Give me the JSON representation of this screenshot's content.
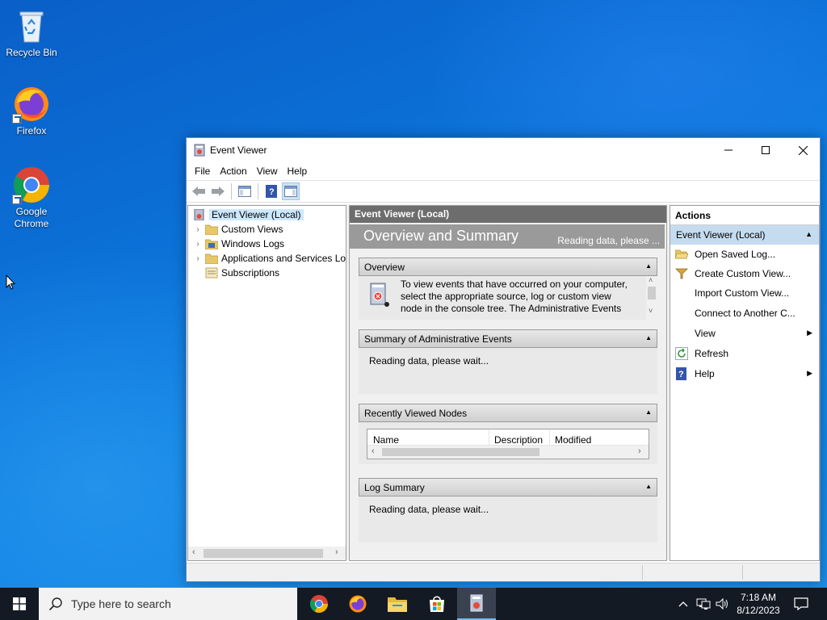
{
  "desktop": {
    "icons": [
      {
        "label": "Recycle Bin"
      },
      {
        "label": "Firefox"
      },
      {
        "label": "Google Chrome"
      }
    ]
  },
  "window": {
    "title": "Event Viewer",
    "menu": [
      "File",
      "Action",
      "View",
      "Help"
    ],
    "tree": [
      {
        "label": "Event Viewer (Local)"
      },
      {
        "label": "Custom Views"
      },
      {
        "label": "Windows Logs"
      },
      {
        "label": "Applications and Services Lo"
      },
      {
        "label": "Subscriptions"
      }
    ],
    "center": {
      "header": "Event Viewer (Local)",
      "banner_title": "Overview and Summary",
      "banner_status": "Reading data, please ...",
      "overview": {
        "title": "Overview",
        "text": [
          "To view events that have occurred on your computer,",
          "select the appropriate source, log or custom view",
          "node in the console tree. The Administrative Events"
        ]
      },
      "summary": {
        "title": "Summary of Administrative Events",
        "text": "Reading data, please wait..."
      },
      "recent": {
        "title": "Recently Viewed Nodes",
        "columns": [
          "Name",
          "Description",
          "Modified"
        ]
      },
      "log_summary": {
        "title": "Log Summary",
        "text": "Reading data, please wait..."
      }
    },
    "actions": {
      "title": "Actions",
      "group": "Event Viewer (Local)",
      "items": [
        {
          "label": "Open Saved Log..."
        },
        {
          "label": "Create Custom View..."
        },
        {
          "label": "Import Custom View..."
        },
        {
          "label": "Connect to Another C..."
        },
        {
          "label": "View"
        },
        {
          "label": "Refresh"
        },
        {
          "label": "Help"
        }
      ]
    }
  },
  "taskbar": {
    "search_placeholder": "Type here to search",
    "time": "7:18 AM",
    "date": "8/12/2023"
  },
  "colors": {
    "accent": "#0078d7",
    "taskbar": "#141a24",
    "selection": "#cce8ff"
  }
}
